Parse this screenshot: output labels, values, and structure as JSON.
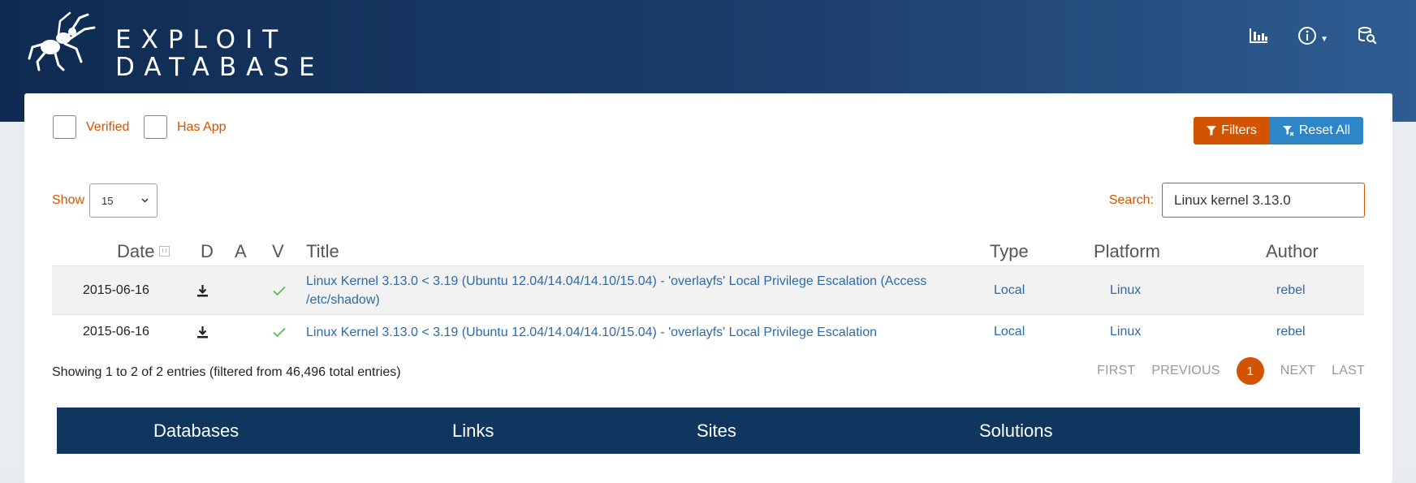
{
  "logo": {
    "line1": "EXPLOIT",
    "line2": "DATABASE"
  },
  "header_icons": [
    "stats-icon",
    "info-icon",
    "search-db-icon"
  ],
  "filters": {
    "verified_label": "Verified",
    "has_app_label": "Has App",
    "filters_button": "Filters",
    "reset_button": "Reset All"
  },
  "table_controls": {
    "show_label": "Show",
    "page_size": "15",
    "search_label": "Search:",
    "search_value": "Linux kernel 3.13.0"
  },
  "columns": {
    "date": "Date",
    "d": "D",
    "a": "A",
    "v": "V",
    "title": "Title",
    "type": "Type",
    "platform": "Platform",
    "author": "Author"
  },
  "rows": [
    {
      "date": "2015-06-16",
      "title": "Linux Kernel 3.13.0 < 3.19 (Ubuntu 12.04/14.04/14.10/15.04) - 'overlayfs' Local Privilege Escalation (Access /etc/shadow)",
      "type": "Local",
      "platform": "Linux",
      "author": "rebel",
      "verified": true
    },
    {
      "date": "2015-06-16",
      "title": "Linux Kernel 3.13.0 < 3.19 (Ubuntu 12.04/14.04/14.10/15.04) - 'overlayfs' Local Privilege Escalation",
      "type": "Local",
      "platform": "Linux",
      "author": "rebel",
      "verified": true
    }
  ],
  "summary": "Showing 1 to 2 of 2 entries (filtered from 46,496 total entries)",
  "pagination": {
    "first": "FIRST",
    "previous": "PREVIOUS",
    "current": "1",
    "next": "NEXT",
    "last": "LAST"
  },
  "footer_nav": [
    "Databases",
    "Links",
    "Sites",
    "Solutions"
  ],
  "colors": {
    "accent": "#d35400",
    "link": "#2d6aa8",
    "reset_button": "#2e86c8",
    "header_dark": "#0f2b52",
    "footer_bar": "#0f365f"
  }
}
